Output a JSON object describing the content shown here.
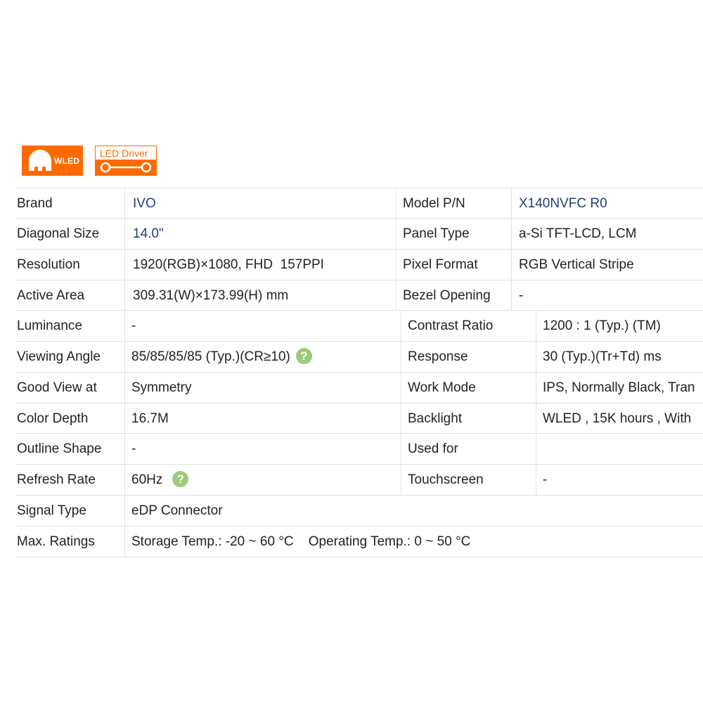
{
  "badges": {
    "wled": "WLED",
    "led_driver": "LED Driver"
  },
  "colors": {
    "accent_orange": "#ff6a00",
    "link_blue": "#1f3f7a",
    "help_green": "#9ccb7a"
  },
  "top_rows": [
    {
      "label": "Brand",
      "value": "IVO",
      "label2": "Model P/N",
      "value2": "X140NVFC R0"
    },
    {
      "label": "Diagonal Size",
      "value": "14.0\"",
      "label2": "Panel Type",
      "value2": "a-Si TFT-LCD, LCM"
    },
    {
      "label": "Resolution",
      "value": "1920(RGB)×1080, FHD  157PPI",
      "label2": "Pixel Format",
      "value2": "RGB Vertical Stripe"
    },
    {
      "label": "Active Area",
      "value": "309.31(W)×173.99(H) mm",
      "label2": "Bezel Opening",
      "value2": "-"
    }
  ],
  "mid_rows": [
    {
      "label": "Luminance",
      "value": "-",
      "label2": "Contrast Ratio",
      "value2": "1200 : 1 (Typ.) (TM)"
    },
    {
      "label": "Viewing Angle",
      "value": "85/85/85/85 (Typ.)(CR≥10)",
      "label2": "Response",
      "value2": "30 (Typ.)(Tr+Td) ms"
    },
    {
      "label": "Good View at",
      "value": "Symmetry",
      "label2": "Work Mode",
      "value2": "IPS, Normally Black, Tran"
    },
    {
      "label": "Color Depth",
      "value": "16.7M",
      "label2": "Backlight",
      "value2": "WLED , 15K hours , With"
    },
    {
      "label": "Outline Shape",
      "value": "-",
      "label2": "Used for",
      "value2_icon": "laptop-icon"
    },
    {
      "label": "Refresh Rate",
      "value": "60Hz",
      "label2": "Touchscreen",
      "value2": "-"
    }
  ],
  "bottom_rows": [
    {
      "label": "Signal Type",
      "value": "eDP Connector"
    },
    {
      "label": "Max. Ratings",
      "value": "Storage Temp.: -20 ~ 60 °C    Operating Temp.: 0 ~ 50 °C"
    }
  ],
  "help_glyph": "?"
}
